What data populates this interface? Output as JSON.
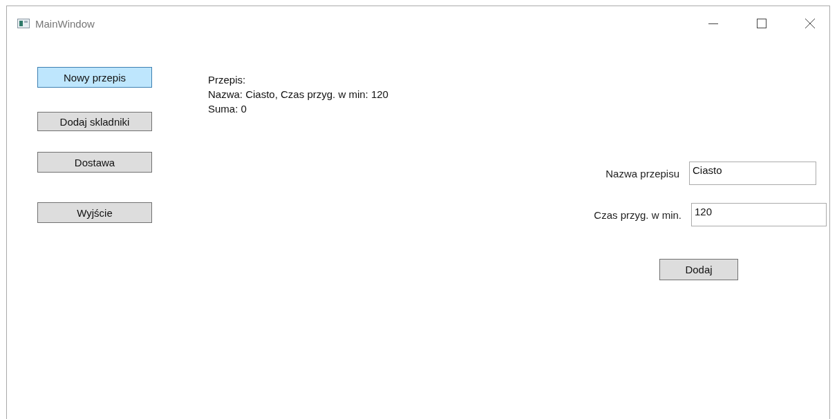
{
  "window": {
    "title": "MainWindow"
  },
  "buttons": [
    {
      "label": "Nowy przepis",
      "focused": true
    },
    {
      "label": "Dodaj skladniki",
      "focused": false
    },
    {
      "label": "Dostawa",
      "focused": false
    },
    {
      "label": "Wyjście",
      "focused": false
    }
  ],
  "summary": {
    "lines": [
      "Przepis:",
      "Nazwa: Ciasto, Czas przyg. w min: 120",
      "Suma: 0"
    ]
  },
  "form": {
    "fields": [
      {
        "label": "Nazwa przepisu",
        "value": "Ciasto"
      },
      {
        "label": "Czas przyg. w min.",
        "value": "120"
      }
    ],
    "submit": "Dodaj"
  }
}
